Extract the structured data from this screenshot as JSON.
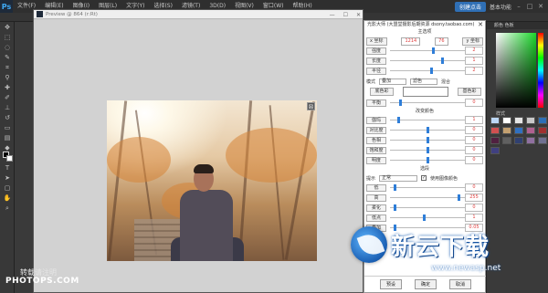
{
  "menubar": {
    "logo": "Ps",
    "items": [
      "文件(F)",
      "编辑(E)",
      "图像(I)",
      "图层(L)",
      "文字(Y)",
      "选择(S)",
      "滤镜(T)",
      "3D(D)",
      "视图(V)",
      "窗口(W)",
      "帮助(H)"
    ],
    "login_label": "创建点击",
    "workspace_label": "基本功能"
  },
  "document": {
    "title": "Preview @ 864 (r:Rt)",
    "ctrl_min": "—",
    "ctrl_max": "☐",
    "ctrl_close": "✕"
  },
  "photo": {
    "close_glyph": "⊠"
  },
  "watermark": {
    "line1": "转载请注明",
    "line2": "PHOTOPS.COM"
  },
  "plugin": {
    "title": "光影大师 (大盟堂摄影后期资源 dsony.taobao.com)",
    "close": "✕",
    "section_main": "主选项",
    "x_label": "x 坐标",
    "x_value": "1214",
    "y_value": "76",
    "y_label": "y 坐标",
    "rows": [
      {
        "label": "强度",
        "value": "2",
        "pos": 0.58
      },
      {
        "label": "长度",
        "value": "1",
        "pos": 0.7
      },
      {
        "label": "半径",
        "value": "2",
        "pos": 0.55
      }
    ],
    "mode_label": "模式",
    "mode_select": "叠加",
    "mode_select2": "滤色",
    "mix_label": "混合",
    "color_left": "底色彩",
    "color_right": "基色彩",
    "row_smooth": {
      "label": "平衡",
      "value": "0",
      "pos": 0.12
    },
    "section_adjust": "改变颜色",
    "adjust_rows": [
      {
        "label": "伽玛",
        "value": "1",
        "pos": 0.1
      },
      {
        "label": "对比度",
        "value": "0",
        "pos": 0.5
      },
      {
        "label": "色相",
        "value": "0",
        "pos": 0.5
      },
      {
        "label": "饱和度",
        "value": "0",
        "pos": 0.5
      },
      {
        "label": "明度",
        "value": "0",
        "pos": 0.5
      }
    ],
    "section_mix": "选段",
    "blend_label": "提示",
    "blend_select": "正常",
    "use_image_label": "使用图像颜色",
    "mix_rows": [
      {
        "label": "低",
        "value": "0",
        "pos": 0.05
      },
      {
        "label": "高",
        "value": "255",
        "pos": 0.92
      },
      {
        "label": "柔化",
        "value": "0",
        "pos": 0.05
      },
      {
        "label": "低点",
        "value": "1",
        "pos": 0.45
      }
    ],
    "extra_row": {
      "label": "叠加",
      "value": "0.05",
      "pos": 0.05
    },
    "btn_left": "预设",
    "btn_ok": "确定",
    "btn_cancel": "取消"
  },
  "right_panel": {
    "tab_color": "颜色  色板",
    "tab_style": "样式",
    "swatch_colors": [
      "#bcd7f5",
      "#ffffff",
      "#e5e5e5",
      "#c9c9c9",
      "#2d6fb6",
      "#d05050",
      "#c3a070",
      "#3070c0",
      "#b06090",
      "#a03030",
      "#502040",
      "#606060",
      "#304070",
      "#9070a0",
      "#707090",
      "#404080"
    ]
  },
  "brand": {
    "name": "新云下载",
    "url": "www.newasp.net"
  }
}
